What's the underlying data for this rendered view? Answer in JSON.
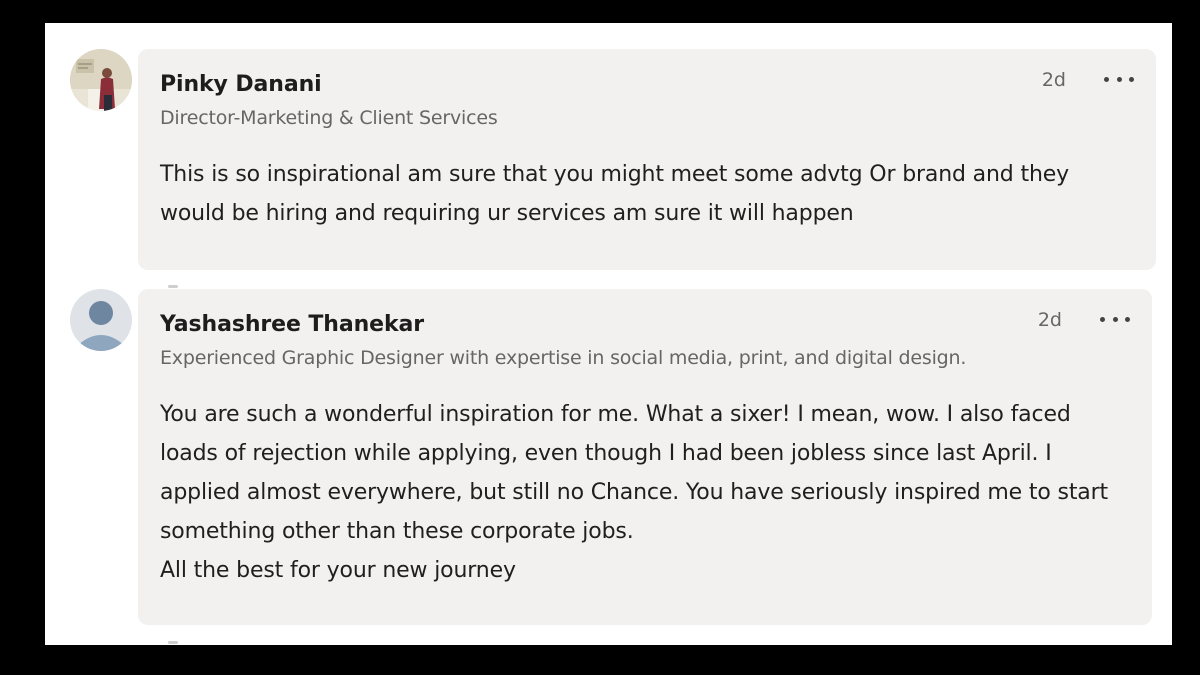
{
  "comments": [
    {
      "author": "Pinky Danani",
      "headline": "Director-Marketing & Client Services",
      "time": "2d",
      "text": "This is so inspirational am sure that you might meet some advtg Or brand and they would be hiring and requiring ur services am sure it will happen",
      "avatar_icon": "profile-photo"
    },
    {
      "author": "Yashashree Thanekar",
      "headline": "Experienced Graphic Designer with expertise in social media, print, and digital design.",
      "time": "2d",
      "text": "You are such a wonderful inspiration for me. What a sixer! I mean, wow. I also faced loads of rejection while applying, even though I had been jobless since last April. I applied almost everywhere, but still no Chance. You have seriously inspired me to start something other than these corporate jobs.\nAll the best for your new journey",
      "avatar_icon": "default-person-avatar"
    }
  ],
  "icons": {
    "more_actions": "ellipsis-icon"
  },
  "colors": {
    "bubble": "#f2f1f0",
    "frame": "#000000",
    "muted_text": "#666666"
  }
}
